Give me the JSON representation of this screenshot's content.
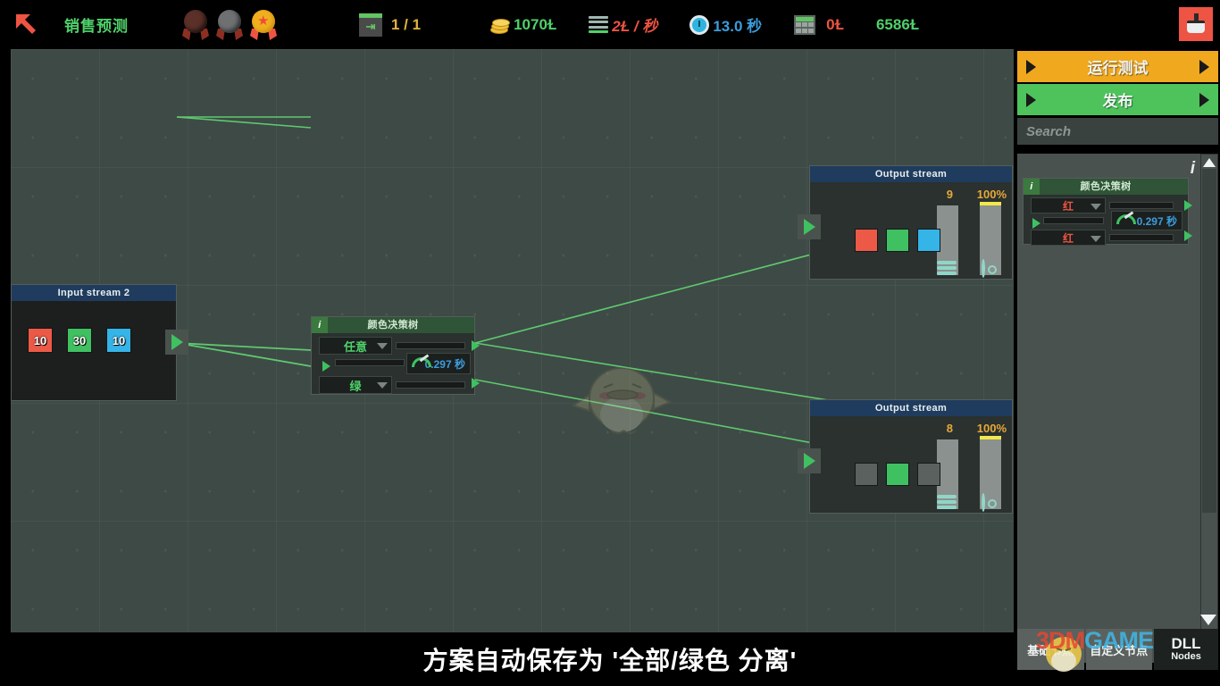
{
  "topbar": {
    "back_icon": "back-arrow-icon",
    "title": "销售预测",
    "medals": [
      {
        "name": "bronze-medal",
        "state": "locked"
      },
      {
        "name": "silver-medal",
        "state": "locked"
      },
      {
        "name": "gold-medal",
        "state": "earned"
      }
    ],
    "stage_icon": "export-icon",
    "stage_value": "1 / 1",
    "stats": [
      {
        "icon": "coins-icon",
        "value": "1070Ɫ",
        "color": "#4fd16a"
      },
      {
        "icon": "rate-icon",
        "value": "2Ɫ / 秒",
        "color": "#ee5443"
      },
      {
        "icon": "stopwatch-icon",
        "value": "13.0 秒",
        "color": "#3c9ddc"
      },
      {
        "icon": "calculator-icon",
        "value": "0Ɫ",
        "color": "#ee5443"
      },
      {
        "icon": "",
        "value": "6586Ɫ",
        "color": "#4fd16a"
      }
    ],
    "clean_icon": "brush-icon"
  },
  "canvas": {
    "input_node": {
      "title": "Input stream 2",
      "swatches": [
        {
          "label": "10",
          "color": "#ec5a47",
          "name": "red"
        },
        {
          "label": "30",
          "color": "#3fc162",
          "name": "green"
        },
        {
          "label": "10",
          "color": "#35b4e8",
          "name": "blue"
        }
      ],
      "output_port": "output-port"
    },
    "decision_node": {
      "info_badge": "i",
      "title": "颜色决策树",
      "dropdown_top": "任意",
      "dropdown_bottom": "绿",
      "gauge_value": "0.297 秒"
    },
    "output_top": {
      "title": "Output stream",
      "count": "9",
      "percent": "100%",
      "swatches": [
        {
          "color": "#ec5a47",
          "active": true
        },
        {
          "color": "#3fc162",
          "active": true
        },
        {
          "color": "#35b4e8",
          "active": true
        }
      ],
      "layers_icon": "layers-icon",
      "target_icon": "target-icon"
    },
    "output_bottom": {
      "title": "Output stream",
      "count": "8",
      "percent": "100%",
      "swatches": [
        {
          "color": "#5a615e",
          "active": false
        },
        {
          "color": "#3fc162",
          "active": true
        },
        {
          "color": "#5a615e",
          "active": false
        }
      ],
      "layers_icon": "layers-icon",
      "target_icon": "target-icon"
    },
    "mascot": "bird-mascot-watermark"
  },
  "caption": "方案自动保存为 '全部/绿色 分离'",
  "panel": {
    "run_test": "运行测试",
    "publish": "发布",
    "search_placeholder": "Search",
    "info_icon": "info-icon",
    "palette_node": {
      "info_badge": "i",
      "title": "颜色决策树",
      "dropdown_top": "红",
      "dropdown_bottom": "红",
      "gauge_value": "0.297 秒"
    },
    "tabs": [
      {
        "label": "基础节点",
        "name": "tab-basic-nodes"
      },
      {
        "label": "自定义节点",
        "name": "tab-custom-nodes"
      }
    ],
    "dll_tab": {
      "big": "DLL",
      "small": "Nodes"
    },
    "scroll_up": "scroll-up-arrow",
    "scroll_down": "scroll-down-arrow"
  },
  "watermark": {
    "a": "3DM",
    "b": "GAME",
    "c": ""
  }
}
